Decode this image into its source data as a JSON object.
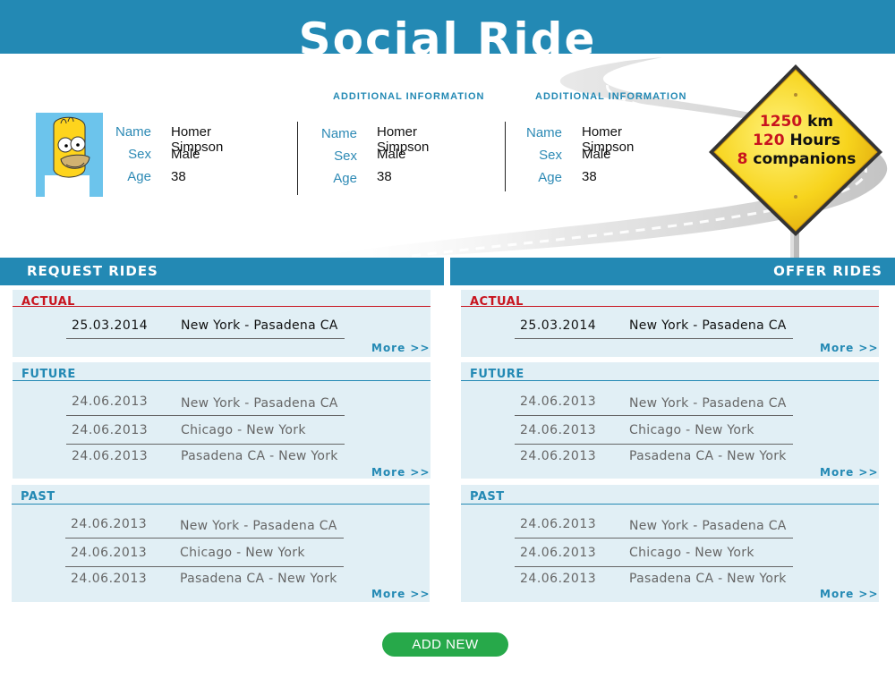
{
  "app": {
    "title": "Social Ride"
  },
  "profile": {
    "name_label": "Name",
    "sex_label": "Sex",
    "age_label": "Age",
    "main": {
      "name": "Homer Simpson",
      "sex": "Male",
      "age": "38"
    },
    "additional": [
      {
        "heading": "ADDITIONAL INFORMATION",
        "name": "Homer Simpson",
        "sex": "Male",
        "age": "38"
      },
      {
        "heading": "ADDITIONAL INFORMATION",
        "name": "Homer Simpson",
        "sex": "Male",
        "age": "38"
      }
    ]
  },
  "sign": {
    "km_value": "1250",
    "km_unit": "km",
    "hours_value": "120",
    "hours_unit": "Hours",
    "companions_value": "8",
    "companions_unit": "companions"
  },
  "sections": {
    "request": {
      "title": "REQUEST RIDES"
    },
    "offer": {
      "title": "OFFER RIDES"
    }
  },
  "rides": {
    "actual": {
      "title": "ACTUAL",
      "rows": [
        {
          "date": "25.03.2014",
          "route": "New York - Pasadena CA"
        }
      ]
    },
    "future": {
      "title": "FUTURE",
      "rows": [
        {
          "date": "24.06.2013",
          "route": "New York - Pasadena CA"
        },
        {
          "date": "24.06.2013",
          "route": "Chicago - New York"
        },
        {
          "date": "24.06.2013",
          "route": "Pasadena CA - New York"
        }
      ]
    },
    "past": {
      "title": "PAST",
      "rows": [
        {
          "date": "24.06.2013",
          "route": "New York - Pasadena CA"
        },
        {
          "date": "24.06.2013",
          "route": "Chicago - New York"
        },
        {
          "date": "24.06.2013",
          "route": "Pasadena CA - New York"
        }
      ]
    },
    "more_label": "More >>"
  },
  "actions": {
    "add_new": "ADD NEW"
  },
  "colors": {
    "brand_blue": "#2389b4",
    "panel_bg": "#e1eff5",
    "actual_red": "#c8141e",
    "button_green": "#27a94a",
    "sign_yellow": "#f7d41d"
  }
}
